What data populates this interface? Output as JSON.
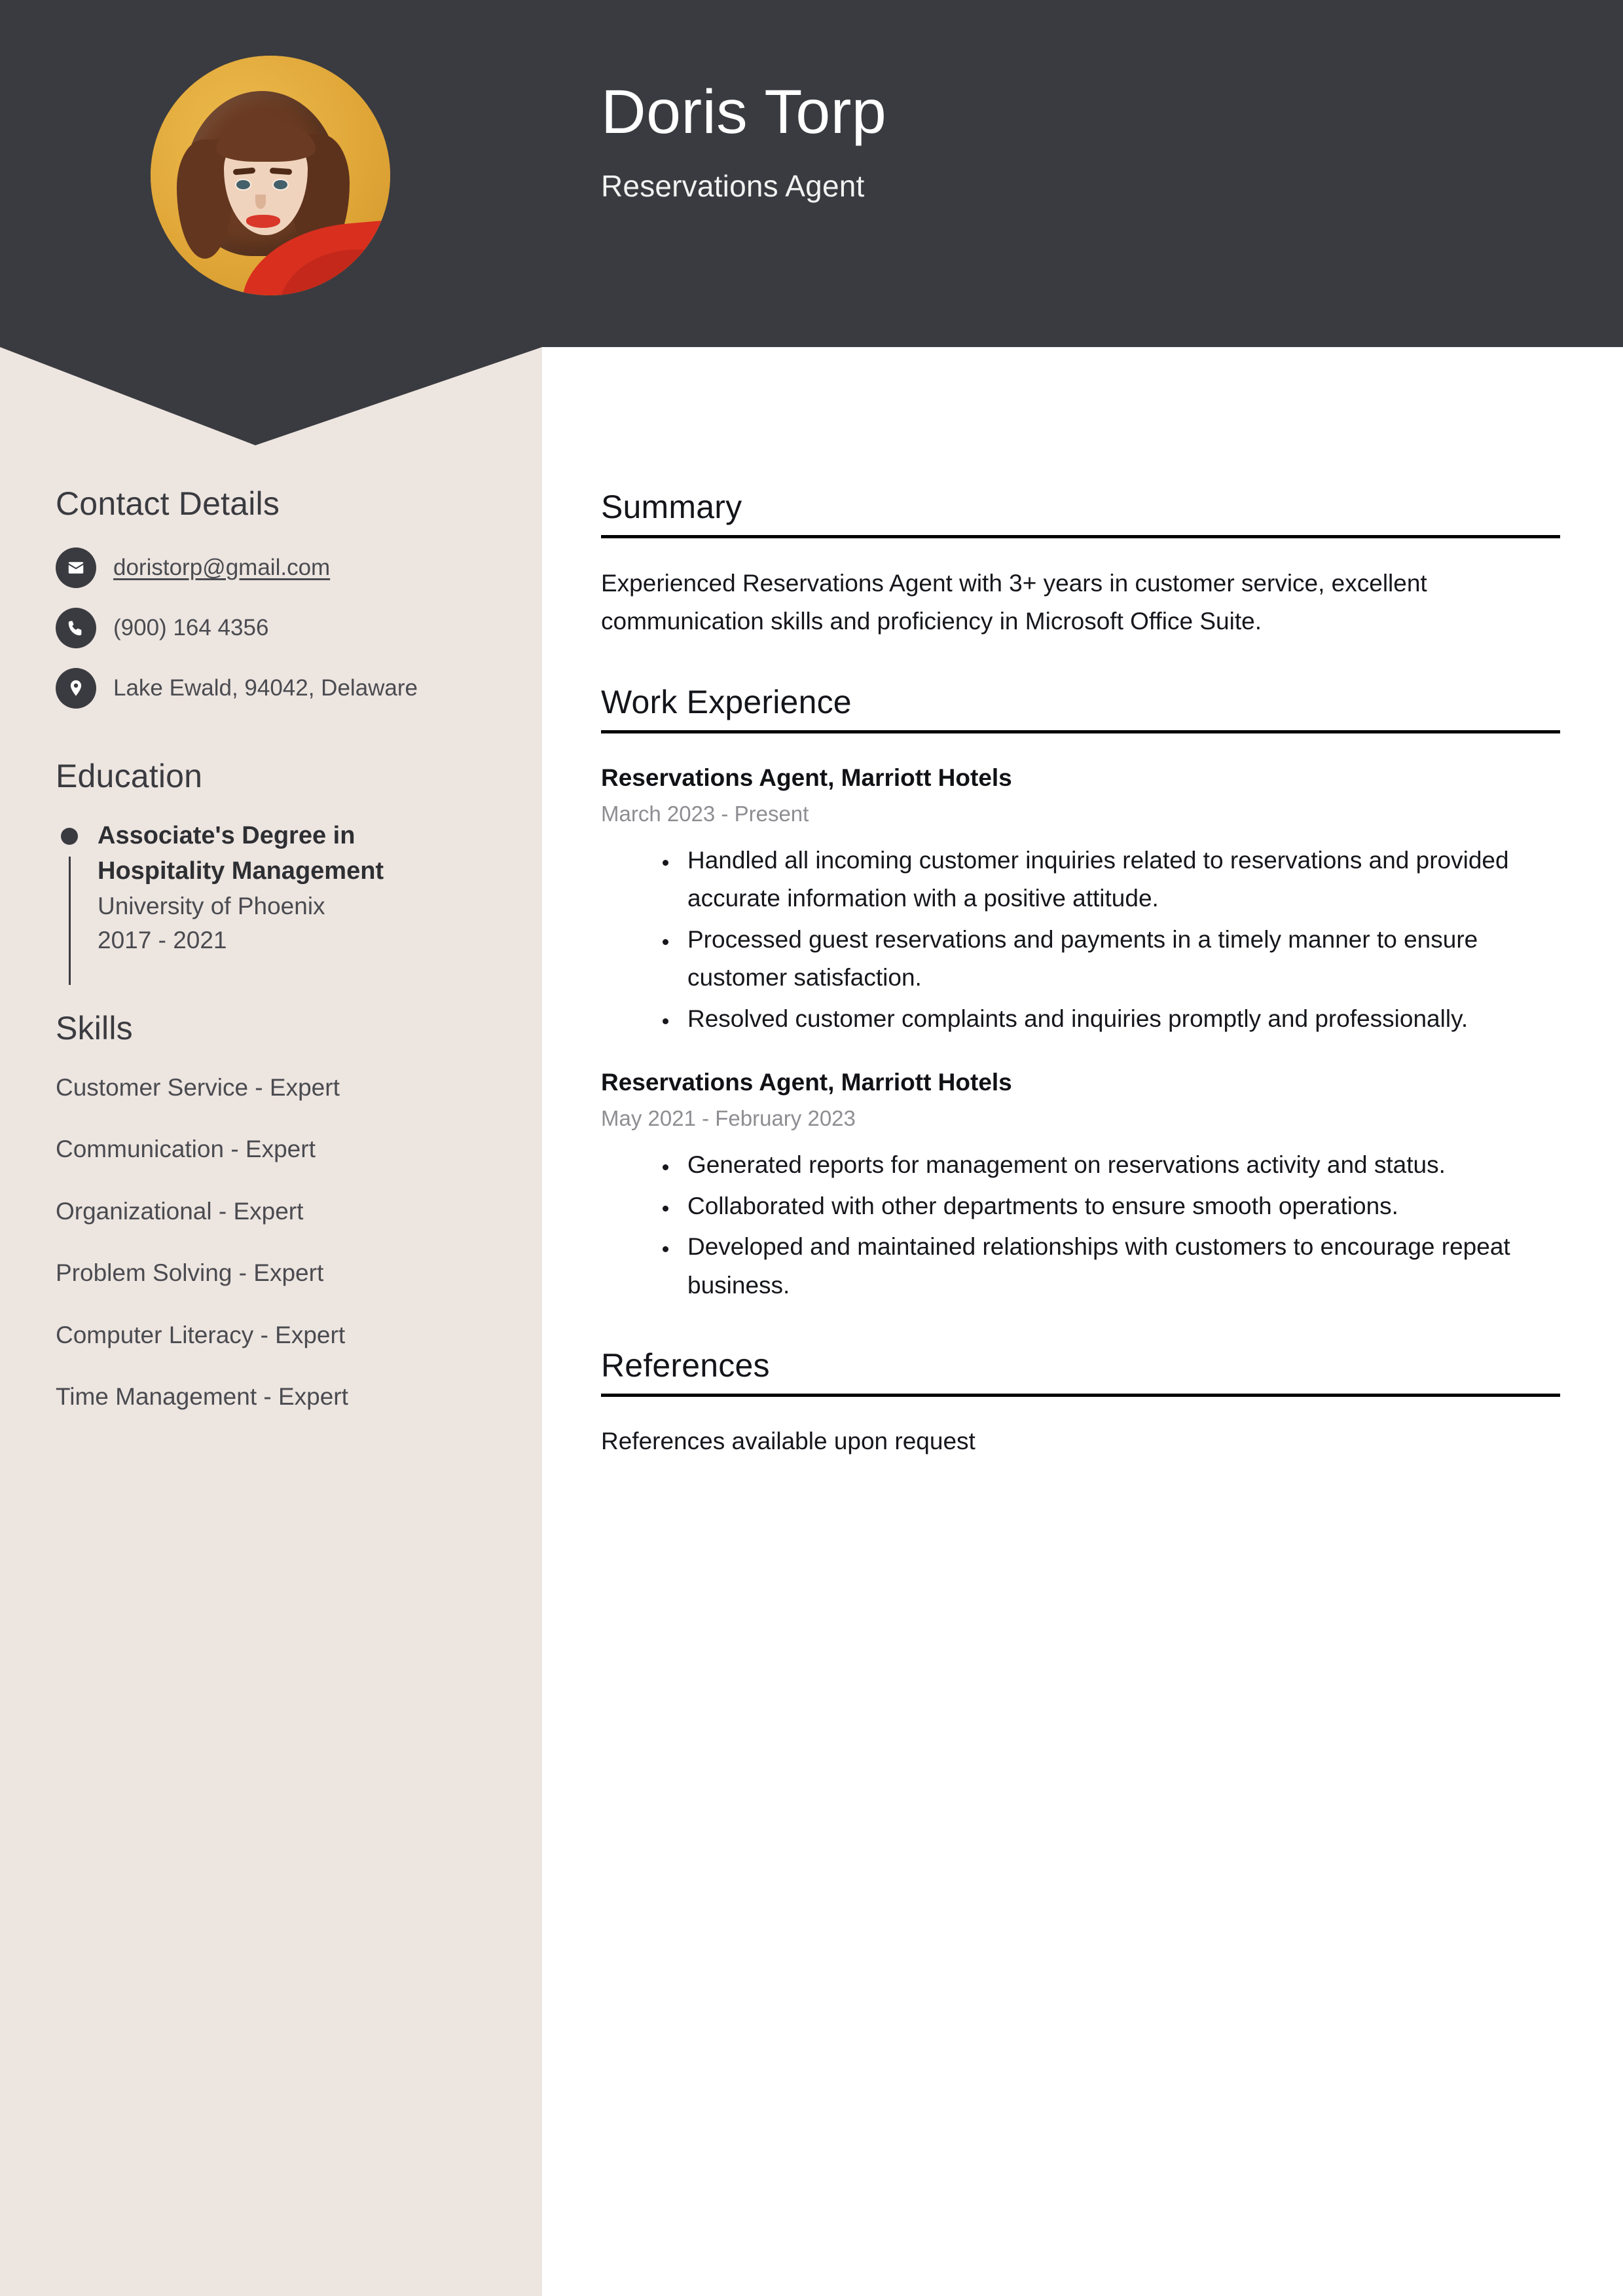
{
  "theme": {
    "header_bg": "#3A3B40",
    "sidebar_bg": "#EDE5E0",
    "main_bg": "#FFFFFF",
    "accent_dark": "#3A3B40",
    "muted_text": "#8D8D92",
    "avatar_bg": "#E2A93A"
  },
  "header": {
    "name": "Doris Torp",
    "job_title": "Reservations Agent"
  },
  "sidebar": {
    "contact": {
      "heading": "Contact Details",
      "items": [
        {
          "icon": "envelope-icon",
          "value": "doristorp@gmail.com",
          "is_link": true
        },
        {
          "icon": "phone-icon",
          "value": "(900) 164 4356",
          "is_link": false
        },
        {
          "icon": "location-pin-icon",
          "value": "Lake Ewald, 94042, Delaware",
          "is_link": false
        }
      ]
    },
    "education": {
      "heading": "Education",
      "items": [
        {
          "degree": "Associate's Degree in Hospitality Management",
          "school": "University of Phoenix",
          "years": "2017 - 2021"
        }
      ]
    },
    "skills": {
      "heading": "Skills",
      "items": [
        "Customer Service - Expert",
        "Communication - Expert",
        "Organizational - Expert",
        "Problem Solving - Expert",
        "Computer Literacy - Expert",
        "Time Management - Expert"
      ]
    }
  },
  "main": {
    "summary": {
      "heading": "Summary",
      "text": "Experienced Reservations Agent with 3+ years in customer service, excellent communication skills and proficiency in Microsoft Office Suite."
    },
    "work_experience": {
      "heading": "Work Experience",
      "jobs": [
        {
          "title": "Reservations Agent, Marriott Hotels",
          "dates": "March 2023 - Present",
          "points": [
            "Handled all incoming customer inquiries related to reservations and provided accurate information with a positive attitude.",
            "Processed guest reservations and payments in a timely manner to ensure customer satisfaction.",
            "Resolved customer complaints and inquiries promptly and professionally."
          ]
        },
        {
          "title": "Reservations Agent, Marriott Hotels",
          "dates": "May 2021 - February 2023",
          "points": [
            "Generated reports for management on reservations activity and status.",
            "Collaborated with other departments to ensure smooth operations.",
            "Developed and maintained relationships with customers to encourage repeat business."
          ]
        }
      ]
    },
    "references": {
      "heading": "References",
      "text": "References available upon request"
    }
  }
}
